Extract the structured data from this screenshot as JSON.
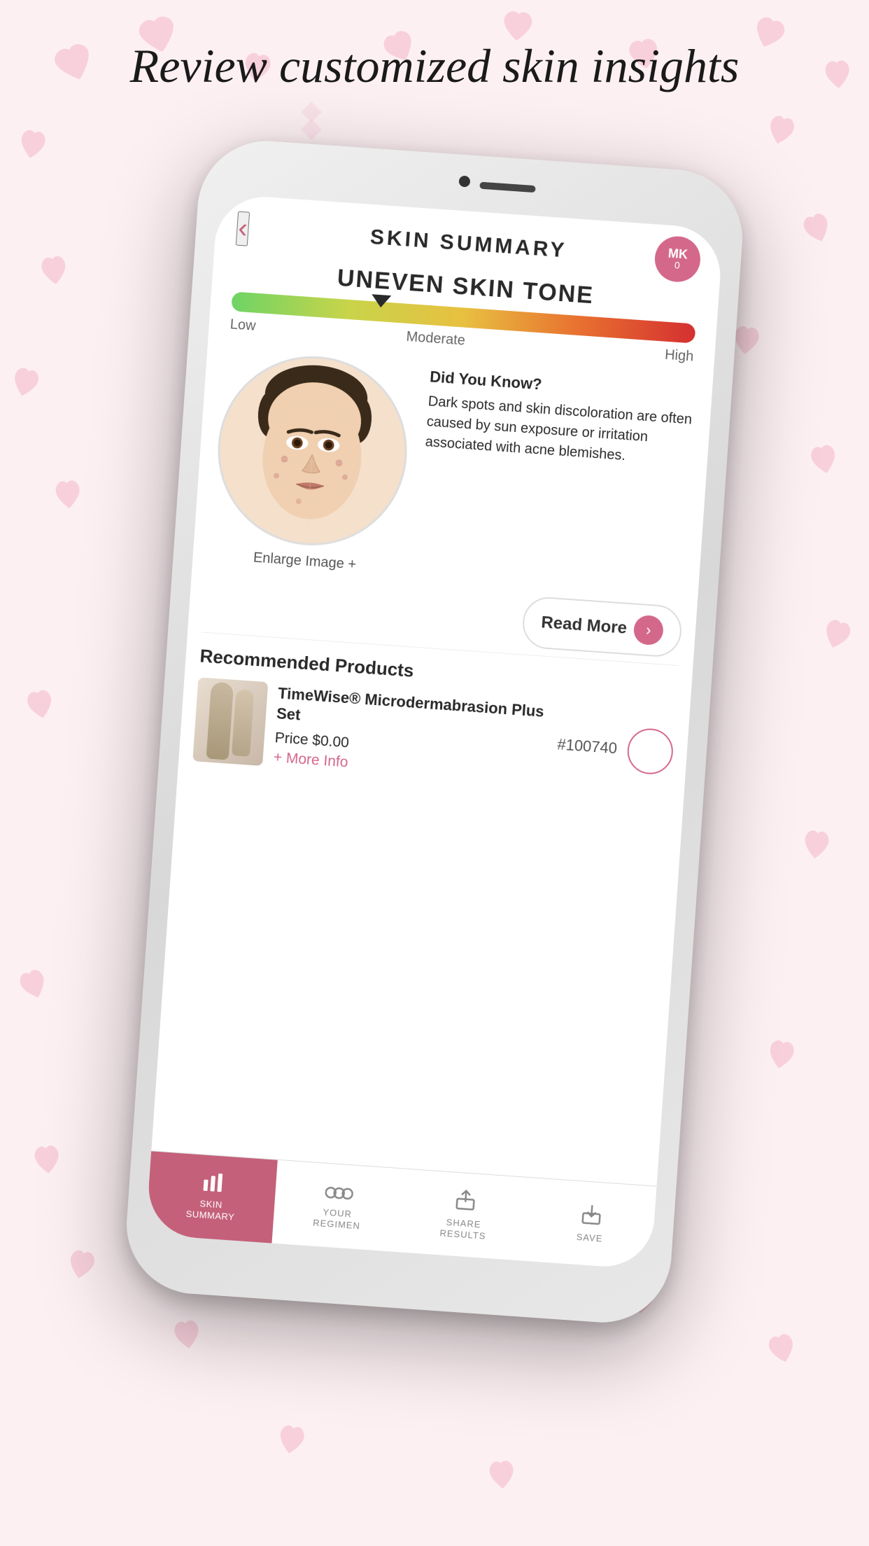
{
  "background": {
    "color": "#fdf0f3"
  },
  "page_title": "Review customized skin insights",
  "header": {
    "back_label": "‹",
    "title": "SKIN SUMMARY",
    "cart_count": "0",
    "cart_icon": "MK"
  },
  "skin_condition": {
    "title": "UNEVEN SKIN TONE",
    "scale": {
      "low_label": "Low",
      "moderate_label": "Moderate",
      "high_label": "High",
      "indicator_position": "30%"
    }
  },
  "face_image": {
    "enlarge_label": "Enlarge Image +"
  },
  "did_you_know": {
    "title": "Did You Know?",
    "text": "Dark spots and skin discoloration are often caused by sun exposure or irritation associated with acne blemishes."
  },
  "read_more_button": {
    "label": "Read More",
    "arrow": "›"
  },
  "recommended_section": {
    "title": "Recommended Products",
    "product": {
      "name": "TimeWise® Microdermabrasion Plus Set",
      "price": "Price $0.00",
      "more_info": "+ More Info",
      "sku": "#100740"
    }
  },
  "bottom_nav": {
    "items": [
      {
        "label": "SKIN\nSUMMARY",
        "icon": "▐▌▐",
        "active": true
      },
      {
        "label": "YOUR\nREGIMEN",
        "icon": "◯◯◯",
        "active": false
      },
      {
        "label": "SHARE\nRESULTS",
        "icon": "⬆",
        "active": false
      },
      {
        "label": "SAVE",
        "icon": "⬇",
        "active": false
      }
    ]
  }
}
